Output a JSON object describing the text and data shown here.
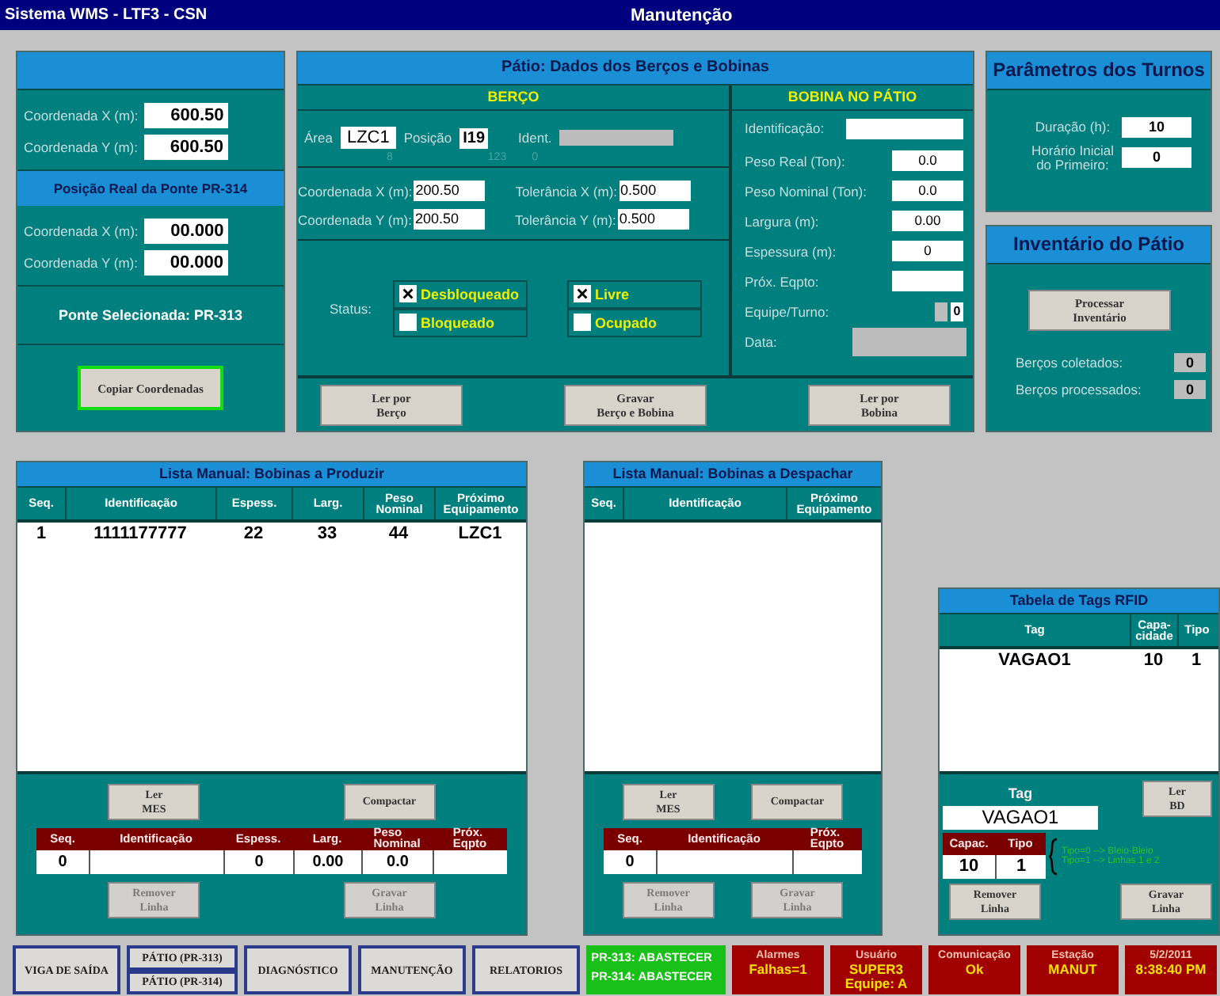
{
  "title_bar": {
    "app": "Sistema WMS - LTF3 - CSN",
    "screen": "Manutenção"
  },
  "bridge_panel": {
    "fields": [
      {
        "label": "Coordenada X (m):",
        "value": "600.50"
      },
      {
        "label": "Coordenada Y (m):",
        "value": "600.50"
      }
    ],
    "section_title": "Posição Real da Ponte PR-314",
    "real_fields": [
      {
        "label": "Coordenada X (m):",
        "value": "00.000"
      },
      {
        "label": "Coordenada Y (m):",
        "value": "00.000"
      }
    ],
    "selected_bridge": "Ponte Selecionada: PR-313",
    "copy_button": {
      "label": "Copiar Coordenadas",
      "focused": true
    }
  },
  "yard_panel": {
    "title": "Pátio: Dados dos Berços e Bobinas",
    "berth": {
      "title": "BERÇO",
      "area_label": "Área",
      "area": "LZC1",
      "position_label": "Posição",
      "position": "I19",
      "ident_label": "Ident.",
      "small_numbers": [
        "8",
        "123",
        "0"
      ],
      "coords": [
        {
          "label": "Coordenada X (m):",
          "value": "200.50",
          "tol_label": "Tolerância X (m):",
          "tol_value": "0.500"
        },
        {
          "label": "Coordenada Y (m):",
          "value": "200.50",
          "tol_label": "Tolerância Y (m):",
          "tol_value": "0.500"
        }
      ],
      "status_label": "Status:",
      "statuses": [
        {
          "label": "Desbloqueado",
          "checked": true
        },
        {
          "label": "Livre",
          "checked": true
        },
        {
          "label": "Bloqueado",
          "checked": false
        },
        {
          "label": "Ocupado",
          "checked": false
        }
      ]
    },
    "coil": {
      "title": "BOBINA NO PÁTIO",
      "fields": [
        {
          "label": "Identificação:",
          "kind": "wide"
        },
        {
          "label": "Peso Real (Ton):",
          "value": "0.0",
          "kind": "box"
        },
        {
          "label": "Peso Nominal (Ton):",
          "value": "0.0",
          "kind": "box"
        },
        {
          "label": "Largura (m):",
          "value": "0.00",
          "kind": "box"
        },
        {
          "label": "Espessura (m):",
          "value": "0",
          "kind": "box"
        },
        {
          "label": "Próx. Eqpto:",
          "kind": "box"
        },
        {
          "label": "Equipe/Turno:",
          "value": "0",
          "kind": "shift"
        },
        {
          "label": "Data:",
          "kind": "date"
        }
      ]
    },
    "buttons": [
      "Ler por\nBerço",
      "Gravar\nBerço e Bobina",
      "Ler por\nBobina"
    ]
  },
  "shift_panel": {
    "title": "Parâmetros dos Turnos",
    "fields": [
      {
        "label": "Duração (h):",
        "value": "10"
      },
      {
        "label": "Horário Inicial\ndo Primeiro:",
        "value": "0"
      }
    ]
  },
  "inventory_panel": {
    "title": "Inventário do Pátio",
    "button": "Processar\nInventário",
    "counts": [
      {
        "label": "Berços coletados:",
        "value": "0"
      },
      {
        "label": "Berços processados:",
        "value": "0"
      }
    ]
  },
  "produce_list": {
    "title": "Lista Manual: Bobinas a Produzir",
    "columns": [
      "Seq.",
      "Identificação",
      "Espess.",
      "Larg.",
      "Peso\nNominal",
      "Próximo\nEquipamento"
    ],
    "rows": [
      [
        "1",
        "1111177777",
        "22",
        "33",
        "44",
        "LZC1"
      ]
    ],
    "top_buttons": [
      "Ler\nMES",
      "Compactar"
    ],
    "edit_columns": [
      {
        "label": "Seq.",
        "value": "0"
      },
      {
        "label": "Identificação"
      },
      {
        "label": "Espess.",
        "value": "0"
      },
      {
        "label": "Larg.",
        "value": "0.00"
      },
      {
        "label": "Peso\nNominal",
        "value": "0.0"
      },
      {
        "label": "Próx.\nEqpto"
      }
    ],
    "bottom_buttons": [
      {
        "label": "Remover\nLinha",
        "disabled": true
      },
      {
        "label": "Gravar\nLinha",
        "disabled": true
      }
    ]
  },
  "dispatch_list": {
    "title": "Lista Manual: Bobinas a Despachar",
    "columns": [
      "Seq.",
      "Identificação",
      "Próximo\nEquipamento"
    ],
    "top_buttons": [
      "Ler\nMES",
      "Compactar"
    ],
    "edit_columns": [
      {
        "label": "Seq.",
        "value": "0"
      },
      {
        "label": "Identificação"
      },
      {
        "label": "Próx.\nEqpto"
      }
    ],
    "bottom_buttons": [
      {
        "label": "Remover\nLinha",
        "disabled": true
      },
      {
        "label": "Gravar\nLinha",
        "disabled": true
      }
    ]
  },
  "rfid_table": {
    "title": "Tabela de Tags RFID",
    "columns": [
      "Tag",
      "Capa-\ncidade",
      "Tipo"
    ],
    "rows": [
      [
        "VAGAO1",
        "10",
        "1"
      ]
    ],
    "tag_label": "Tag",
    "tag_value": "VAGAO1",
    "read_button": "Ler\nBD",
    "edit_columns": [
      "Capac.",
      "Tipo"
    ],
    "edit_values": [
      "10",
      "1"
    ],
    "notes": [
      "Tipo=0 --> Bleio-Bleio",
      "Tipo=1 --> Linhas 1 e 2"
    ],
    "buttons": [
      {
        "label": "Remover\nLinha",
        "disabled": false
      },
      {
        "label": "Gravar\nLinha",
        "disabled": false
      }
    ]
  },
  "bottom_bar": {
    "nav": [
      {
        "kind": "button",
        "labels": [
          "VIGA DE SAÍDA"
        ]
      },
      {
        "kind": "stack",
        "labels": [
          "PÁTIO (PR-313)",
          "PÁTIO (PR-314)"
        ]
      },
      {
        "kind": "button",
        "labels": [
          "DIAGNÓSTICO"
        ]
      },
      {
        "kind": "button",
        "labels": [
          "MANUTENÇÃO"
        ]
      },
      {
        "kind": "button",
        "labels": [
          "RELATORIOS"
        ]
      }
    ],
    "cells": [
      {
        "kind": "status",
        "lines": [
          "PR-313: ABASTECER",
          "PR-314: ABASTECER"
        ]
      },
      {
        "kind": "alarm",
        "lines": [
          "Alarmes",
          "Falhas=1"
        ]
      },
      {
        "kind": "alarm",
        "lines": [
          "Usuário",
          "SUPER3",
          "Equipe: A"
        ]
      },
      {
        "kind": "alarm",
        "lines": [
          "Comunicação",
          "Ok"
        ]
      },
      {
        "kind": "alarm",
        "lines": [
          "Estação",
          "MANUT"
        ]
      },
      {
        "kind": "alarm",
        "lines": [
          "5/2/2011",
          "8:38:40 PM"
        ]
      }
    ]
  }
}
